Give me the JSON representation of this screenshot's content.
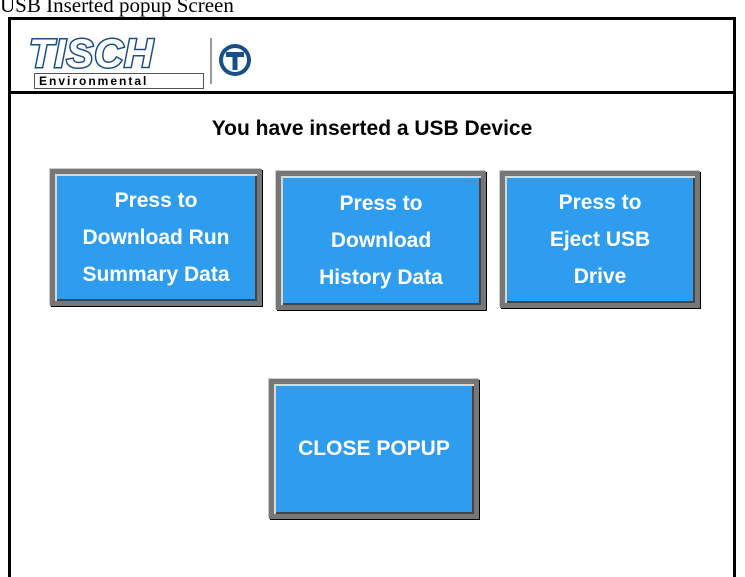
{
  "caption": "USB Inserted popup Screen",
  "logo": {
    "name": "TISCH",
    "sub": "Environmental"
  },
  "title": "You have inserted a USB Device",
  "buttons": {
    "download_run_summary": "Press to\nDownload Run\nSummary Data",
    "download_history": "Press to\nDownload\nHistory Data",
    "eject_usb": "Press to\nEject USB\nDrive",
    "close_popup": "CLOSE POPUP"
  },
  "colors": {
    "button": "#2e9df0",
    "brand": "#1a4e86"
  }
}
